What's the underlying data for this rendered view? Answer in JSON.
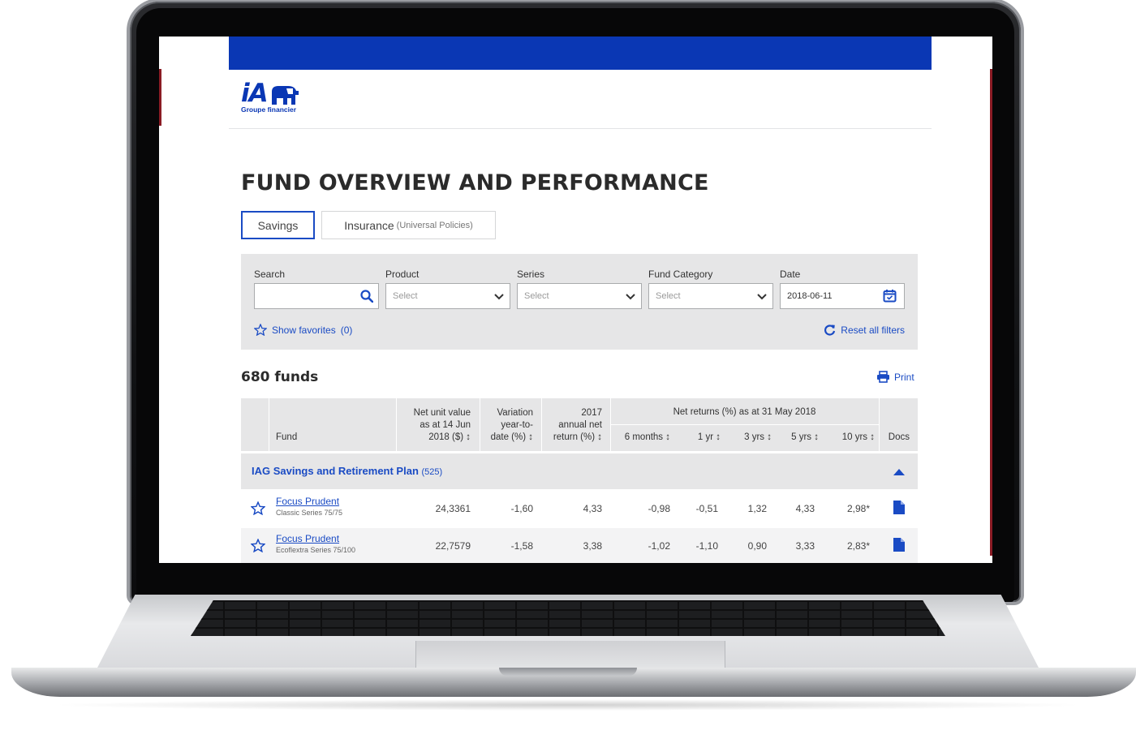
{
  "header": {
    "logo_text": "iA",
    "logo_subtitle": "Groupe financier"
  },
  "page": {
    "title": "FUND OVERVIEW AND PERFORMANCE"
  },
  "tabs": [
    {
      "label": "Savings",
      "suffix": "",
      "active": true
    },
    {
      "label": "Insurance",
      "suffix": "(Universal Policies)",
      "active": false
    }
  ],
  "filters": {
    "search_label": "Search",
    "search_value": "",
    "product_label": "Product",
    "product_value": "Select",
    "series_label": "Series",
    "series_value": "Select",
    "category_label": "Fund Category",
    "category_value": "Select",
    "date_label": "Date",
    "date_value": "2018-06-11",
    "show_favorites": "Show favorites",
    "favorites_count": "(0)",
    "reset": "Reset all filters"
  },
  "results": {
    "count": "680 funds",
    "print": "Print"
  },
  "table": {
    "headers": {
      "fund": "Fund",
      "nuv1": "Net unit value",
      "nuv2": "as at 14 Jun",
      "nuv3": "2018 ($) ↕",
      "var1": "Variation",
      "var2": "year-to-",
      "var3": "date (%) ↕",
      "ann1": "2017",
      "ann2": "annual net",
      "ann3": "return (%) ↕",
      "net_returns": "Net returns (%) as at 31 May 2018",
      "m6": "6 months ↕",
      "y1": "1 yr ↕",
      "y3": "3 yrs ↕",
      "y5": "5 yrs ↕",
      "y10": "10 yrs ↕",
      "docs": "Docs"
    },
    "group": {
      "name": "IAG Savings and Retirement Plan",
      "count": "(525)"
    },
    "rows": [
      {
        "name": "Focus Prudent",
        "series": "Classic Series 75/75",
        "nuv": "24,3361",
        "ytd": "-1,60",
        "annual": "4,33",
        "m6": "-0,98",
        "y1": "-0,51",
        "y3": "1,32",
        "y5": "4,33",
        "y10": "2,98*"
      },
      {
        "name": "Focus Prudent",
        "series": "Ecoflextra Series 75/100",
        "nuv": "22,7579",
        "ytd": "-1,58",
        "annual": "3,38",
        "m6": "-1,02",
        "y1": "-1,10",
        "y3": "0,90",
        "y5": "3,33",
        "y10": "2,83*"
      }
    ]
  },
  "colors": {
    "brand_blue": "#0a37b4",
    "link_blue": "#1a4bc4",
    "panel_gray": "#e6e6e7"
  }
}
